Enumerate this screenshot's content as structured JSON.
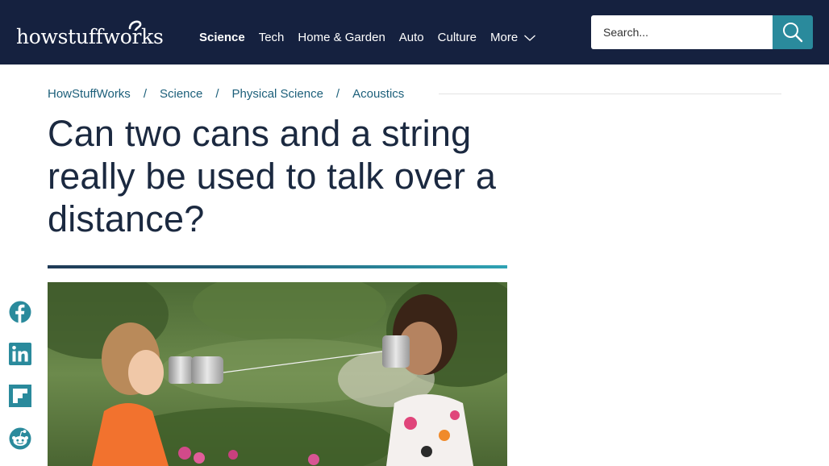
{
  "header": {
    "logo_text": "howstuffworks",
    "nav": [
      {
        "label": "Science",
        "active": true
      },
      {
        "label": "Tech",
        "active": false
      },
      {
        "label": "Home & Garden",
        "active": false
      },
      {
        "label": "Auto",
        "active": false
      },
      {
        "label": "Culture",
        "active": false
      }
    ],
    "more_label": "More",
    "search": {
      "placeholder": "Search..."
    }
  },
  "breadcrumb": [
    "HowStuffWorks",
    "Science",
    "Physical Science",
    "Acoustics"
  ],
  "breadcrumb_separator": "/",
  "article": {
    "title": "Can two cans and a string really be used to talk over a distance?"
  },
  "share": [
    {
      "network": "facebook",
      "icon": "facebook-icon"
    },
    {
      "network": "linkedin",
      "icon": "linkedin-icon"
    },
    {
      "network": "flipboard",
      "icon": "flipboard-icon"
    },
    {
      "network": "reddit",
      "icon": "reddit-icon"
    }
  ],
  "colors": {
    "header_bg": "#15213f",
    "accent": "#2a8a9c",
    "link": "#1c5f7a",
    "title": "#1b2940",
    "share_icon": "#2a8a9c"
  }
}
